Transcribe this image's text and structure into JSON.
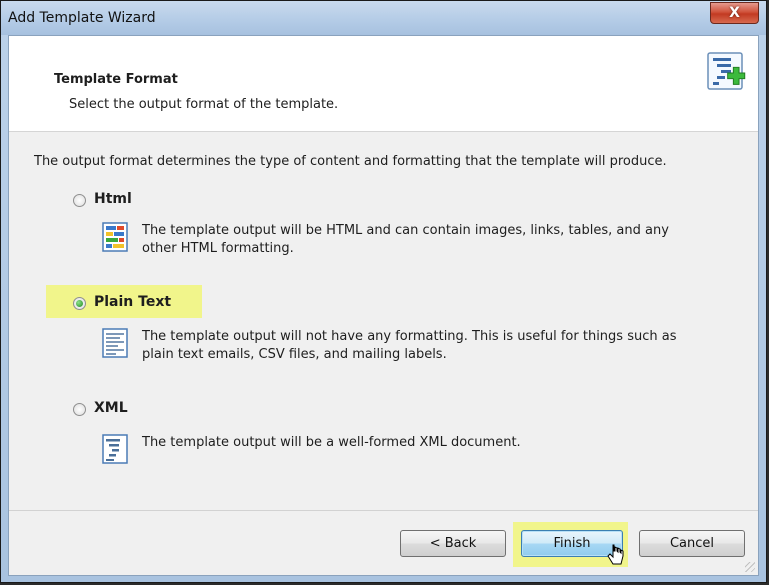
{
  "window": {
    "title": "Add Template Wizard",
    "close_label": "X"
  },
  "header": {
    "title": "Template Format",
    "subtitle": "Select the output format of the template.",
    "icon": "template-add-icon"
  },
  "intro": "The output format determines the type of content and formatting that the template will produce.",
  "options": [
    {
      "label": "Html",
      "selected": false,
      "icon": "html-format-icon",
      "desc_line1": "The template output will be HTML and can contain images, links, tables, and any",
      "desc_line2": "other HTML formatting."
    },
    {
      "label": "Plain Text",
      "selected": true,
      "icon": "plain-text-format-icon",
      "desc_line1": "The template output will not have any formatting.  This is useful for things such as",
      "desc_line2": "plain text emails, CSV files, and mailing labels."
    },
    {
      "label": "XML",
      "selected": false,
      "icon": "xml-format-icon",
      "desc_line1": "The template output will be a well-formed XML document.",
      "desc_line2": ""
    }
  ],
  "buttons": {
    "back": "< Back",
    "finish": "Finish",
    "cancel": "Cancel"
  },
  "colors": {
    "highlight": "#f1f58b",
    "accent_green": "#2fa52f"
  }
}
